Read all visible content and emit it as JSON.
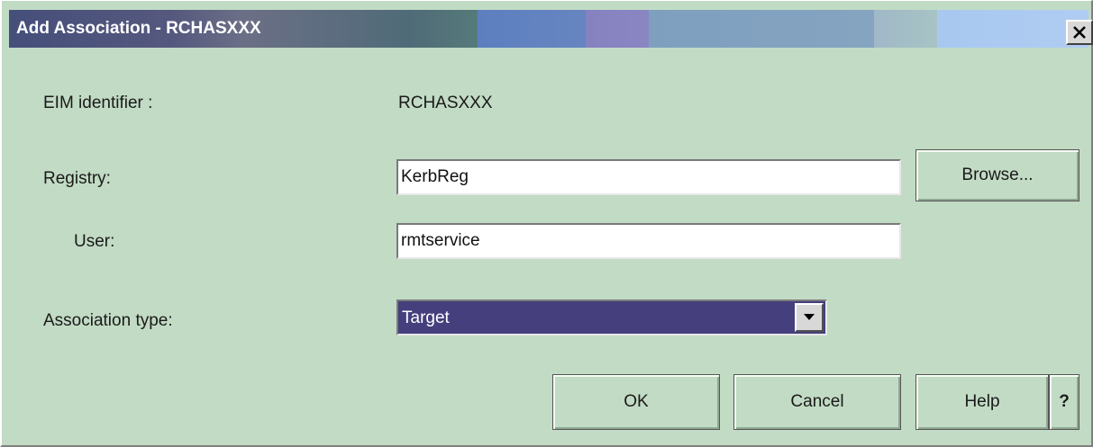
{
  "window": {
    "title": "Add Association - RCHASXXX",
    "close_label": "✕"
  },
  "form": {
    "eim_label": "EIM identifier :",
    "eim_value": "RCHASXXX",
    "registry_label": "Registry:",
    "registry_value": "KerbReg",
    "browse_label": "Browse...",
    "user_label": "User:",
    "user_value": "rmtservice",
    "assoc_label": "Association type:",
    "assoc_value": "Target"
  },
  "buttons": {
    "ok": "OK",
    "cancel": "Cancel",
    "help": "Help",
    "question": "?"
  },
  "colors": {
    "background": "#c2dbc4",
    "select_highlight": "#453f7d"
  }
}
